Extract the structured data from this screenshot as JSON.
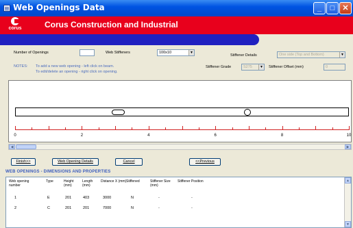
{
  "window": {
    "title": "Web Openings Data"
  },
  "brand": {
    "logo_text": "corus",
    "company": "Corus Construction and Industrial",
    "color": "#e8001c",
    "accent": "#2020c0"
  },
  "settings": {
    "num_openings_label": "Number of Openings",
    "num_openings_value": "",
    "web_stiffeners_label": "Web Stiffeners",
    "web_stiffeners_value": "100x10",
    "stiffener_details_label": "Stiffener Details",
    "stiffener_details_value": "One side (Top and Bottom)",
    "stiffener_grade_label": "Stiffener Grade",
    "stiffener_grade_value": "S275",
    "stiffener_offset_label": "Stiffener Offset (mm)",
    "stiffener_offset_value": "0",
    "notes_label": "NOTES:",
    "note_1": "To add a new web opening - left click on beam.",
    "note_2": "To edit/delete an opening - right click on opening."
  },
  "ruler": {
    "ticks": [
      "0",
      "2",
      "4",
      "6",
      "8",
      "10"
    ],
    "max": 10
  },
  "openings_visual": [
    {
      "shape": "rectangular",
      "position": 3.0
    },
    {
      "shape": "circular",
      "position": 7.0
    }
  ],
  "buttons": {
    "finish": "Finish>>",
    "web_opening_details": "Web Opening Details",
    "cancel": "Cancel",
    "previous": "<<Previous"
  },
  "table": {
    "section_title": "WEB OPENINGS - DIMENSIONS AND PROPERTIES",
    "headers": {
      "opening_number": "Web opening number",
      "type": "Type",
      "height": "Height (mm)",
      "length": "Length (mm)",
      "distance": "Distance X (mm)",
      "stiffened": "Stiffened",
      "stiffener_size": "Stiffener Size (mm)",
      "stiffener_position": "Stiffener Position"
    },
    "rows": [
      {
        "number": "1",
        "type": "E",
        "height": "201",
        "length": "403",
        "distance": "3000",
        "stiffened": "N",
        "stiffener_size": "-",
        "stiffener_position": "-"
      },
      {
        "number": "2",
        "type": "C",
        "height": "201",
        "length": "201",
        "distance": "7000",
        "stiffened": "N",
        "stiffener_size": "-",
        "stiffener_position": "-"
      }
    ]
  }
}
